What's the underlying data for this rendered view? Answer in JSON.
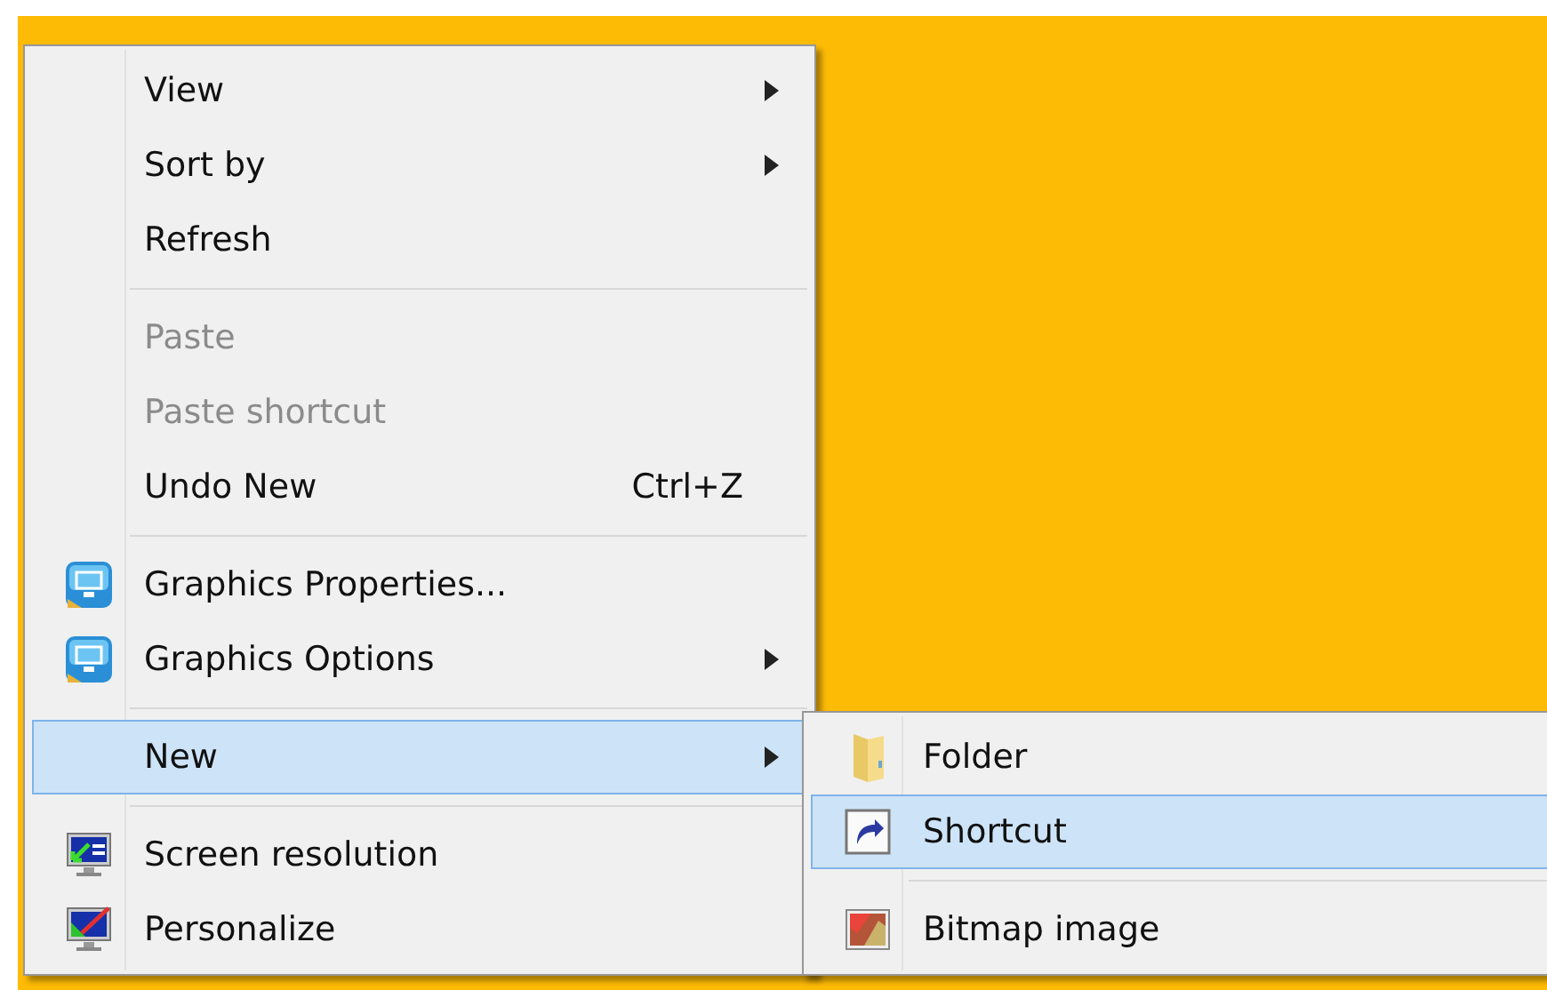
{
  "menu": {
    "items": [
      {
        "kind": "plain",
        "label": "View",
        "submenu": true,
        "disabled": false,
        "selected": false
      },
      {
        "kind": "plain",
        "label": "Sort by",
        "submenu": true,
        "disabled": false,
        "selected": false
      },
      {
        "kind": "plain",
        "label": "Refresh",
        "submenu": false,
        "disabled": false,
        "selected": false
      },
      {
        "kind": "separator"
      },
      {
        "kind": "plain",
        "label": "Paste",
        "submenu": false,
        "disabled": true,
        "selected": false
      },
      {
        "kind": "plain",
        "label": "Paste shortcut",
        "submenu": false,
        "disabled": true,
        "selected": false
      },
      {
        "kind": "plain",
        "label": "Undo New",
        "shortcut": "Ctrl+Z",
        "submenu": false,
        "disabled": false,
        "selected": false
      },
      {
        "kind": "separator"
      },
      {
        "kind": "graphics",
        "label": "Graphics Properties...",
        "submenu": false,
        "disabled": false,
        "selected": false
      },
      {
        "kind": "graphics",
        "label": "Graphics Options",
        "submenu": true,
        "disabled": false,
        "selected": false
      },
      {
        "kind": "separator"
      },
      {
        "kind": "plain",
        "label": "New",
        "submenu": true,
        "disabled": false,
        "selected": true
      },
      {
        "kind": "separator"
      },
      {
        "kind": "display",
        "label": "Screen resolution",
        "submenu": false,
        "disabled": false,
        "selected": false
      },
      {
        "kind": "personalize",
        "label": "Personalize",
        "submenu": false,
        "disabled": false,
        "selected": false
      }
    ]
  },
  "submenu": {
    "items": [
      {
        "kind": "folder",
        "label": "Folder",
        "submenu": false,
        "disabled": false,
        "selected": false
      },
      {
        "kind": "shortcut",
        "label": "Shortcut",
        "submenu": false,
        "disabled": false,
        "selected": true
      },
      {
        "kind": "separator"
      },
      {
        "kind": "bitmap",
        "label": "Bitmap image",
        "submenu": false,
        "disabled": false,
        "selected": false
      }
    ]
  }
}
